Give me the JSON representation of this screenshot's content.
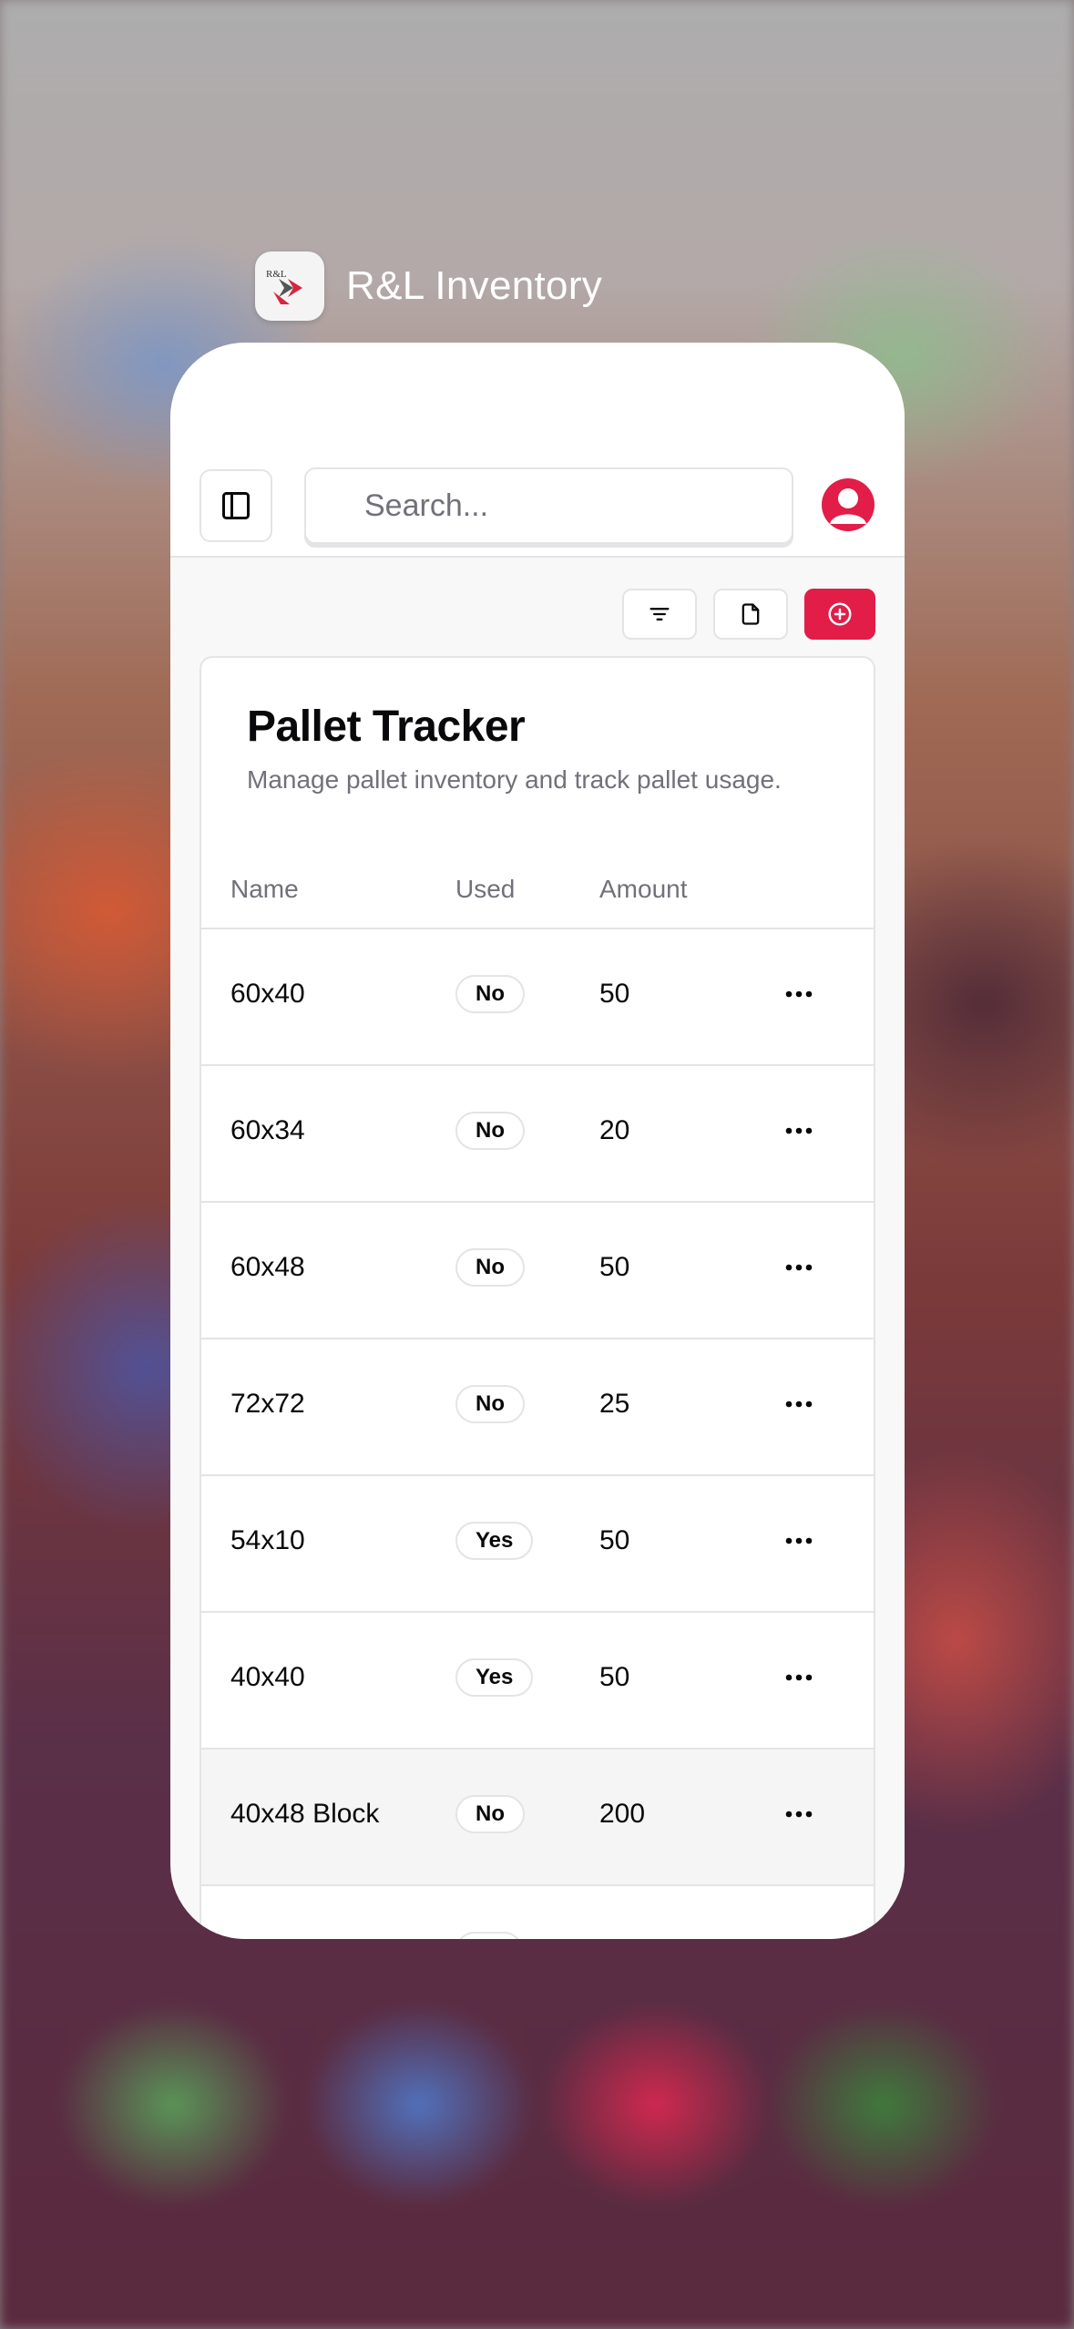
{
  "app": {
    "name": "R&L Inventory",
    "logo_text": "R&L"
  },
  "header": {
    "search_placeholder": "Search..."
  },
  "panel": {
    "title": "Pallet Tracker",
    "description": "Manage pallet inventory and track pallet usage."
  },
  "table": {
    "columns": {
      "name": "Name",
      "used": "Used",
      "amount": "Amount"
    },
    "rows": [
      {
        "name": "60x40",
        "used": "No",
        "amount": "50"
      },
      {
        "name": "60x34",
        "used": "No",
        "amount": "20"
      },
      {
        "name": "60x48",
        "used": "No",
        "amount": "50"
      },
      {
        "name": "72x72",
        "used": "No",
        "amount": "25"
      },
      {
        "name": "54x10",
        "used": "Yes",
        "amount": "50"
      },
      {
        "name": "40x40",
        "used": "Yes",
        "amount": "50"
      },
      {
        "name": "40x48 Block",
        "used": "No",
        "amount": "200"
      }
    ]
  },
  "colors": {
    "accent": "#e11d48",
    "border": "#e4e4e7",
    "muted": "#71717a"
  },
  "icons": {
    "sidebar": "sidebar-toggle-icon",
    "avatar": "user-icon",
    "filter": "filter-icon",
    "export": "document-icon",
    "add": "plus-circle-icon",
    "row_menu": "more-horizontal-icon"
  }
}
